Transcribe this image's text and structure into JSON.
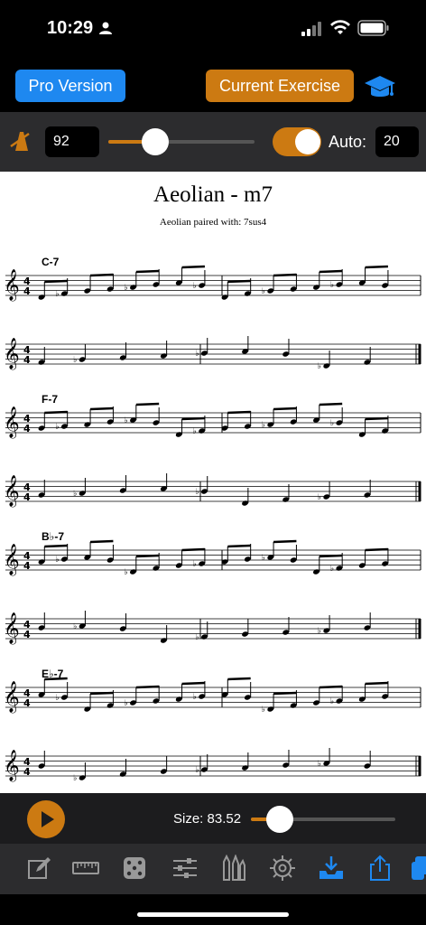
{
  "status": {
    "time": "10:29"
  },
  "header": {
    "pro_label": "Pro Version",
    "current_label": "Current Exercise"
  },
  "controls": {
    "tempo": "92",
    "tempo_level": 0.32,
    "auto_label": "Auto:",
    "auto_value": "20",
    "auto_on": true
  },
  "sheet": {
    "title": "Aeolian - m7",
    "subtitle": "Aeolian paired with: 7sus4",
    "chords": [
      "C-7",
      "F-7",
      "B♭-7",
      "E♭-7"
    ]
  },
  "bottom": {
    "size_label": "Size: 83.52",
    "size_level": 0.2
  },
  "colors": {
    "accent_orange": "#CC7A12",
    "accent_blue": "#1E88F0"
  },
  "tabbar": {
    "icons": [
      "edit-icon",
      "ruler-icon",
      "dice-icon",
      "sliders-icon",
      "instruments-icon",
      "settings-gear-icon",
      "download-tray-icon",
      "share-icon",
      "copy-icon"
    ]
  }
}
